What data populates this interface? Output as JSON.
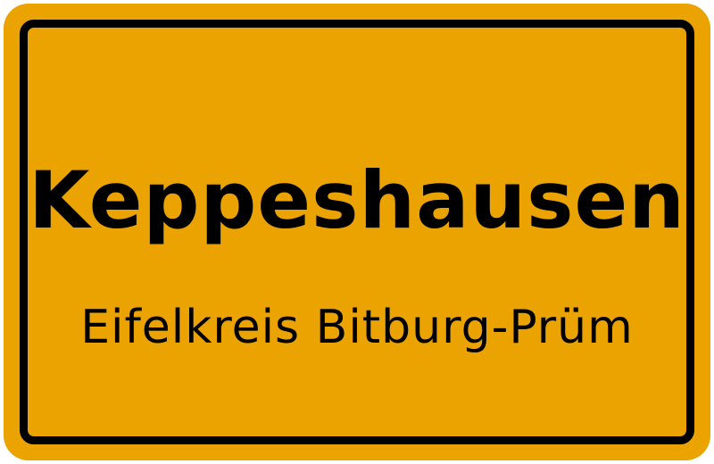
{
  "sign": {
    "place_name": "Keppeshausen",
    "district_name": "Eifelkreis Bitburg-Prüm",
    "colors": {
      "background": "#eaa300",
      "border": "#000000",
      "text": "#000000"
    }
  }
}
